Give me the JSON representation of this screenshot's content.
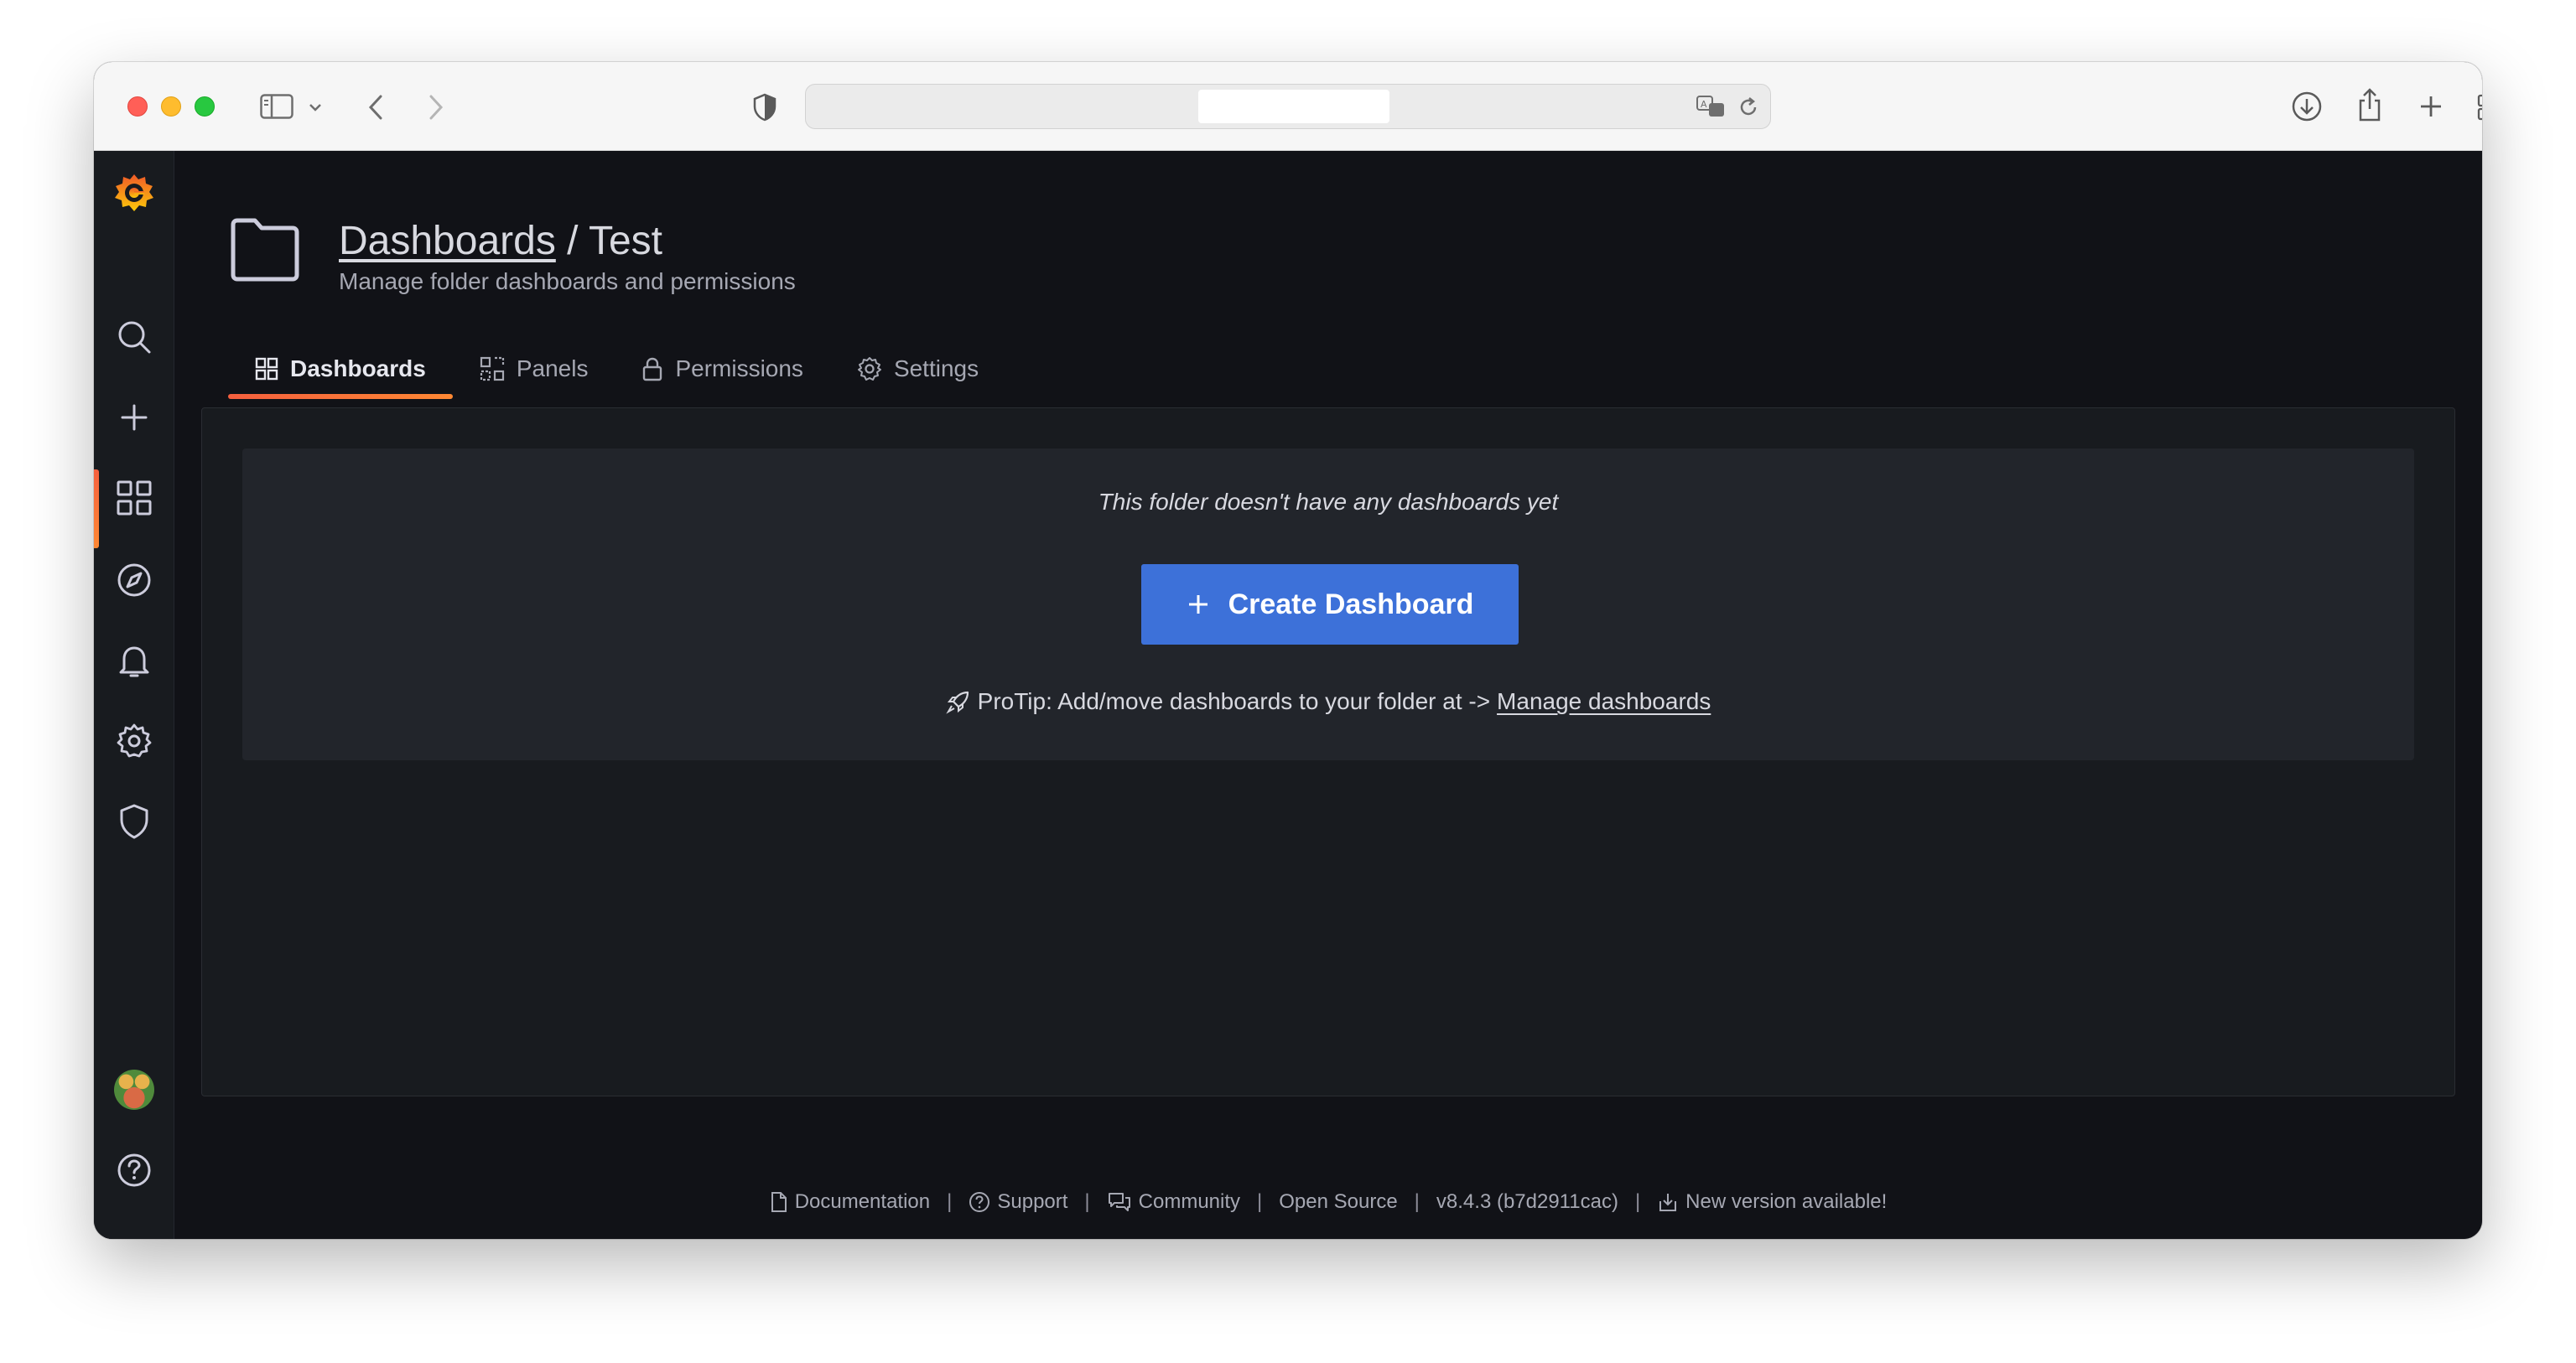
{
  "browser": {
    "url": ""
  },
  "sidebar": {
    "items": [
      {
        "name": "grafana-logo",
        "icon": "grafana-logo-icon"
      },
      {
        "name": "search",
        "icon": "search-icon"
      },
      {
        "name": "create",
        "icon": "plus-icon"
      },
      {
        "name": "dashboards",
        "icon": "grid-icon",
        "active": true
      },
      {
        "name": "explore",
        "icon": "compass-icon"
      },
      {
        "name": "alerting",
        "icon": "bell-icon"
      },
      {
        "name": "configuration",
        "icon": "gear-icon"
      },
      {
        "name": "server-admin",
        "icon": "shield-icon"
      },
      {
        "name": "profile",
        "icon": "avatar"
      },
      {
        "name": "help",
        "icon": "question-icon"
      }
    ]
  },
  "header": {
    "breadcrumb_link": "Dashboards",
    "separator": " / ",
    "folder_name": "Test",
    "subtitle": "Manage folder dashboards and permissions"
  },
  "tabs": [
    {
      "label": "Dashboards",
      "icon": "grid-icon",
      "active": true
    },
    {
      "label": "Panels",
      "icon": "panels-icon",
      "active": false
    },
    {
      "label": "Permissions",
      "icon": "lock-icon",
      "active": false
    },
    {
      "label": "Settings",
      "icon": "gear-icon",
      "active": false
    }
  ],
  "empty_state": {
    "message": "This folder doesn't have any dashboards yet",
    "button_label": "Create Dashboard",
    "protip_text": "ProTip: Add/move dashboards to your folder at ->",
    "protip_link": "Manage dashboards"
  },
  "footer": {
    "documentation": "Documentation",
    "support": "Support",
    "community": "Community",
    "open_source": "Open Source",
    "version": "v8.4.3 (b7d2911cac)",
    "new_version": "New version available!",
    "separator": "|"
  },
  "colors": {
    "primary_button": "#3d71d9",
    "active_accent": "#f55f3e",
    "background": "#111217",
    "sidebar": "#181b1f"
  }
}
